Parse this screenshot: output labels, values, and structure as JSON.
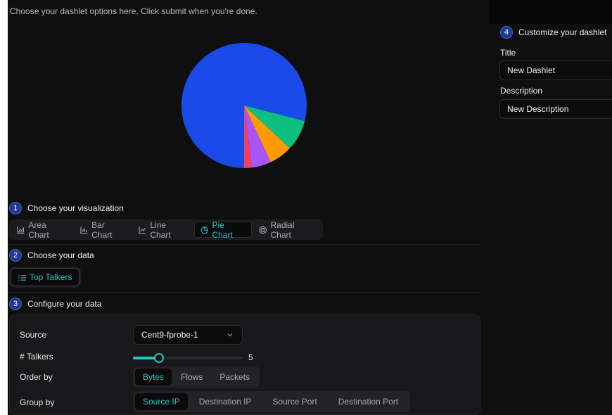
{
  "intro_text": "Choose your dashlet options here. Click submit when you're done.",
  "colors": {
    "accent": "#24c9c2",
    "step_badge": "#1c3b8c"
  },
  "chart_data": {
    "type": "pie",
    "values": [
      79,
      8,
      6,
      5,
      2
    ],
    "colors": [
      "#1a4ae8",
      "#0dbf7e",
      "#ff9a00",
      "#a855f7",
      "#f43f5e"
    ],
    "start_angle_deg": 90,
    "direction": "clockwise"
  },
  "steps": {
    "s1": {
      "num": "1",
      "title": "Choose your visualization"
    },
    "s2": {
      "num": "2",
      "title": "Choose your data"
    },
    "s3": {
      "num": "3",
      "title": "Configure your data"
    },
    "s4": {
      "num": "4",
      "title": "Customize your dashlet"
    }
  },
  "visualizations": [
    {
      "label": "Area Chart",
      "icon": "area-chart-icon",
      "active": false
    },
    {
      "label": "Bar Chart",
      "icon": "bar-chart-icon",
      "active": false
    },
    {
      "label": "Line Chart",
      "icon": "line-chart-icon",
      "active": false
    },
    {
      "label": "Pie Chart",
      "icon": "pie-chart-icon",
      "active": true
    },
    {
      "label": "Radial Chart",
      "icon": "radial-chart-icon",
      "active": false
    }
  ],
  "data_source": {
    "label": "Top Talkers",
    "icon": "list-icon"
  },
  "config": {
    "source_label": "Source",
    "source_value": "Cent9-fprobe-1",
    "talkers_label": "# Talkers",
    "talkers_value": "5",
    "talkers_fraction": 0.24,
    "order_label": "Order by",
    "order_options": [
      "Bytes",
      "Flows",
      "Packets"
    ],
    "order_selected": 0,
    "group_label": "Group by",
    "group_options": [
      "Source IP",
      "Destination IP",
      "Source Port",
      "Destination Port"
    ],
    "group_selected": 0
  },
  "customize": {
    "title_label": "Title",
    "title_value": "New Dashlet",
    "description_label": "Description",
    "description_value": "New Description"
  }
}
